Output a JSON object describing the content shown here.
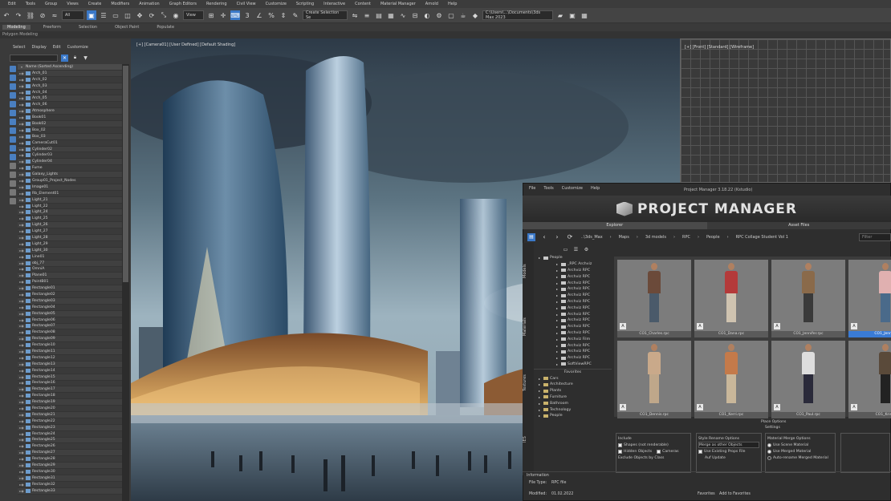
{
  "menubar": [
    "Edit",
    "Tools",
    "Group",
    "Views",
    "Create",
    "Modifiers",
    "Animation",
    "Graph Editors",
    "Rendering",
    "Civil View",
    "Customize",
    "Scripting",
    "Interactive",
    "Content",
    "Material Manager",
    "Arnold",
    "Help"
  ],
  "toolbar": {
    "view_dropdown": "All",
    "ref_dropdown": "View",
    "selection_set": "Create Selection Se",
    "workspace": "C:\\Users\\...\\Documents\\3ds Max 2023"
  },
  "ribbon": {
    "tabs": [
      "Modeling",
      "Freeform",
      "Selection",
      "Object Paint",
      "Populate"
    ],
    "sub": "Polygon Modeling"
  },
  "explorer": {
    "menu": [
      "Select",
      "Display",
      "Edit",
      "Customize"
    ],
    "root_label": "Name (Sorted Ascending)",
    "items": [
      "Arch_01",
      "Arch_02",
      "Arch_03",
      "Arch_04",
      "Arch_05",
      "Arch_06",
      "Atmosphere",
      "Book01",
      "Book02",
      "Box_02",
      "Box_03",
      "CameraCut01",
      "Cylinder02",
      "Cylinder03",
      "Cylinder04",
      "Fume",
      "Galaxy_Lights",
      "Group01_Project_Nodes",
      "Image01",
      "Rb_Element01",
      "Light_21",
      "Light_22",
      "Light_24",
      "Light_25",
      "Light_26",
      "Light_27",
      "Light_28",
      "Light_29",
      "Light_30",
      "Line01",
      "obj_77",
      "OmniA",
      "Plane01",
      "PointB01",
      "Rectangle01",
      "Rectangle02",
      "Rectangle03",
      "Rectangle04",
      "Rectangle05",
      "Rectangle06",
      "Rectangle07",
      "Rectangle08",
      "Rectangle09",
      "Rectangle10",
      "Rectangle11",
      "Rectangle12",
      "Rectangle13",
      "Rectangle14",
      "Rectangle15",
      "Rectangle16",
      "Rectangle17",
      "Rectangle18",
      "Rectangle19",
      "Rectangle20",
      "Rectangle21",
      "Rectangle22",
      "Rectangle23",
      "Rectangle24",
      "Rectangle25",
      "Rectangle26",
      "Rectangle27",
      "Rectangle28",
      "Rectangle29",
      "Rectangle30",
      "Rectangle31",
      "Rectangle32",
      "Rectangle33"
    ]
  },
  "viewport": {
    "label": "[+] [Camera01] [User Defined] [Default Shading]",
    "right_label": "[+] [Front] [Standard] [Wireframe]"
  },
  "project_manager": {
    "menu": [
      "File",
      "Tools",
      "Customize",
      "Help"
    ],
    "window_title": "Project Manager 3.18.22 (Kstudio)",
    "banner": "PROJECT MANAGER",
    "tabs": [
      "Explorer",
      "Asset Files"
    ],
    "breadcrumbs": [
      "..\\3ds_Max",
      "Maps",
      "3d models",
      "RPC",
      "People",
      "RPC Collage Student Vol 1"
    ],
    "filter_placeholder": "Filter",
    "vertical_tabs": [
      "Models",
      "Materials",
      "Textures",
      "IES"
    ],
    "tree_top": [
      "People",
      "_RPC Archviz",
      "Archviz RPC",
      "Archviz RPC",
      "Archviz RPC",
      "Archviz RPC",
      "Archviz RPC",
      "Archviz RPC",
      "Archviz RPC",
      "Archviz RPC",
      "Archviz RPC",
      "Archviz RPC",
      "Archviz RPC",
      "Archviz Film",
      "Archviz RPC",
      "Archviz RPC",
      "Archviz RPC",
      "SoftViewRPC"
    ],
    "favorites_label": "Favorites",
    "tree_bottom": [
      "Cars",
      "Architecture",
      "Plants",
      "Furniture",
      "Bathroom",
      "Technology",
      "People"
    ],
    "thumbnails": [
      "CO1_Charles.rpc",
      "CO1_Dana.rpc",
      "CO1_Jennifer.rpc",
      "CO1_Jennife",
      "CO1_Dennis.rpc",
      "CO1_Kerri.rpc",
      "CO1_Paul.rpc",
      "CO1_Kristo"
    ],
    "place_options": "Place Options",
    "settings_label": "Settings",
    "include": {
      "title": "Include",
      "opts": [
        "Shapes (not renderable)",
        "Hidden Objects",
        "Cameras",
        "Exclude Objects by Class"
      ]
    },
    "style_rename": {
      "title": "Style Rename Options",
      "dropdown": "Merge as other Objects",
      "opts": [
        "Use Existing Props File",
        "Auf Update"
      ]
    },
    "material_merge": {
      "title": "Material Merge Options",
      "opts": [
        "Use Scene Material",
        "Use Merged Material",
        "Auto-rename Merged Material"
      ]
    },
    "info": {
      "title": "Information",
      "file_type_label": "File Type:",
      "file_type": "RPC file",
      "modified_label": "Modified:",
      "modified": "01.02.2022",
      "favorites": "Favorites",
      "add_to_favorites": "Add to Favorites"
    }
  }
}
